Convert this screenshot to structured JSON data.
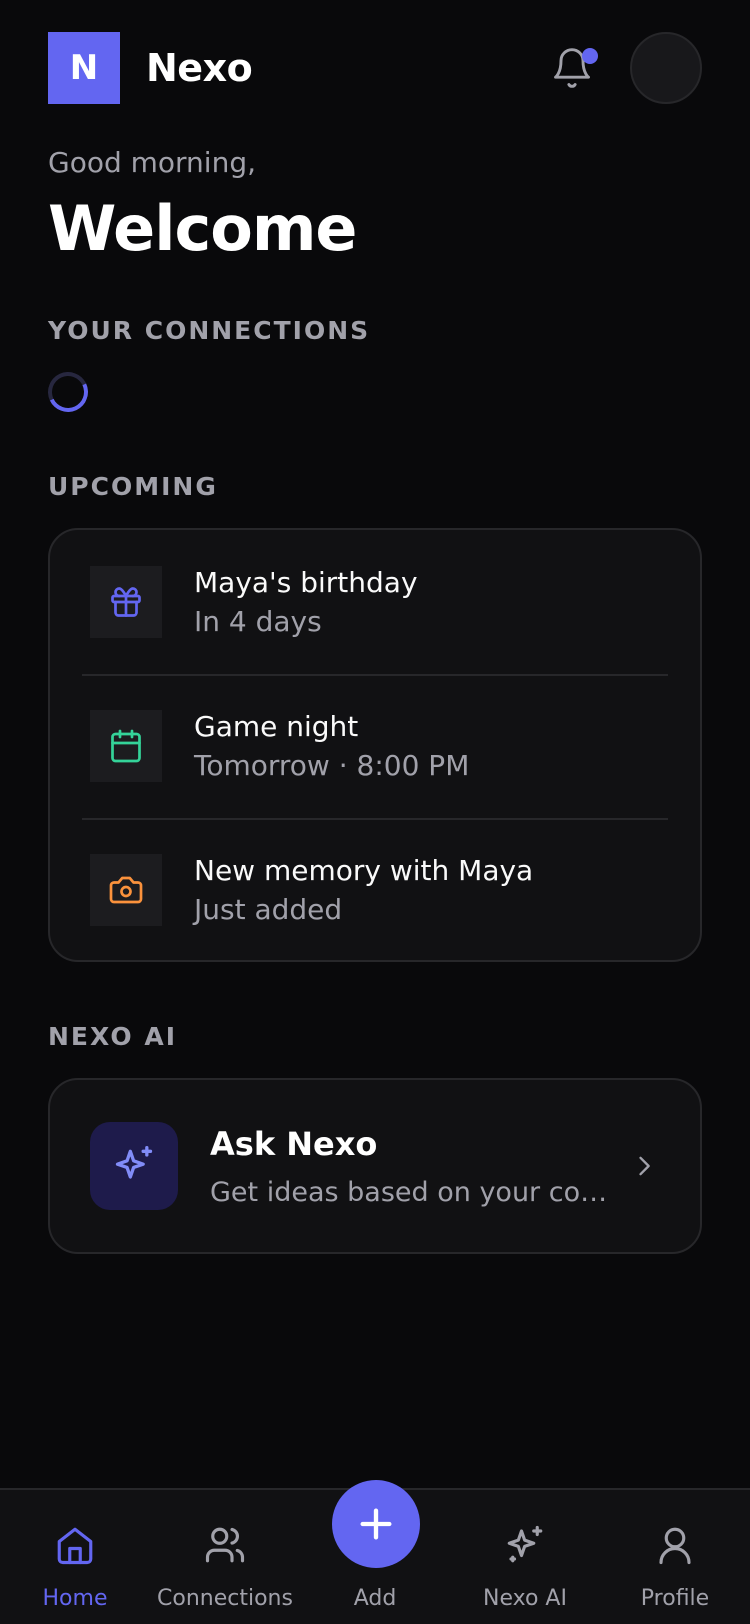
{
  "header": {
    "logo_letter": "N",
    "app_name": "Nexo",
    "notification_dot": true
  },
  "greeting": {
    "line1": "Good morning,",
    "title": "Welcome"
  },
  "sections": {
    "connections_label": "YOUR CONNECTIONS",
    "upcoming_label": "UPCOMING",
    "ai_label": "NEXO AI"
  },
  "upcoming": [
    {
      "icon": "gift-icon",
      "title": "Maya's birthday",
      "subtitle": "In 4 days",
      "color": "#6366f1"
    },
    {
      "icon": "calendar-icon",
      "title": "Game night",
      "subtitle": "Tomorrow · 8:00 PM",
      "color": "#34d399"
    },
    {
      "icon": "camera-icon",
      "title": "New memory with Maya",
      "subtitle": "Just added",
      "color": "#fb923c"
    }
  ],
  "ai_card": {
    "title": "Ask Nexo",
    "subtitle": "Get ideas based on your connections"
  },
  "nav": {
    "items": [
      {
        "label": "Home",
        "icon": "home-icon",
        "active": true
      },
      {
        "label": "Connections",
        "icon": "users-icon",
        "active": false
      },
      {
        "label": "Add",
        "icon": "plus-icon",
        "active": false
      },
      {
        "label": "Nexo AI",
        "icon": "sparkle-icon",
        "active": false
      },
      {
        "label": "Profile",
        "icon": "user-icon",
        "active": false
      }
    ]
  },
  "colors": {
    "accent": "#6366f1",
    "background": "#09090b",
    "card": "#111113"
  }
}
